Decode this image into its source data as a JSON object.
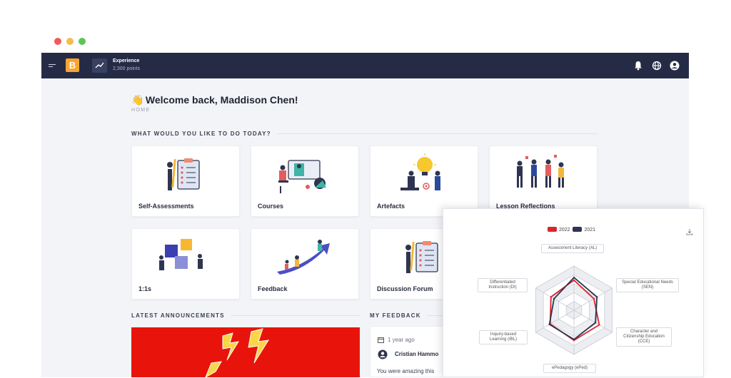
{
  "app": {
    "experience_title": "Experience",
    "experience_points": "2,300 points",
    "logo_letter": "B"
  },
  "page": {
    "welcome": "Welcome back, Maddison Chen!",
    "breadcrumb": "HOME",
    "todo_title": "WHAT WOULD YOU LIKE TO DO TODAY?",
    "announcements_title": "LATEST ANNOUNCEMENTS",
    "feedback_title": "MY FEEDBACK"
  },
  "cards": [
    {
      "label": "Self-Assessments",
      "icon": "clipboard-illustration"
    },
    {
      "label": "Courses",
      "icon": "online-course-illustration"
    },
    {
      "label": "Artefacts",
      "icon": "idea-illustration"
    },
    {
      "label": "Lesson Reflections",
      "icon": "team-illustration"
    },
    {
      "label": "1:1s",
      "icon": "puzzle-illustration"
    },
    {
      "label": "Feedback",
      "icon": "growth-arrow-illustration"
    },
    {
      "label": "Discussion Forum",
      "icon": "clipboard-illustration"
    }
  ],
  "feedback": {
    "time": "1 year ago",
    "name": "Cristian Hammo",
    "message": "You were amazing this"
  },
  "colors": {
    "topbar": "#262b45",
    "accent": "#f7a531",
    "series_2022": "#d8262d",
    "series_2021": "#2c3554"
  },
  "chart_data": {
    "type": "radar",
    "categories": [
      "Assessment Literacy (AL)",
      "Special Educational Needs (SEN)",
      "Character and Citizenship Education (CCE)",
      "ePedagogy (ePed)",
      "Inquiry-based Learning (IBL)",
      "Differentiated Instruction (DI)"
    ],
    "series": [
      {
        "name": "2022",
        "values": [
          3.4,
          2.6,
          3.3,
          3.4,
          3.1,
          3.0
        ]
      },
      {
        "name": "2021",
        "values": [
          3.7,
          3.0,
          2.8,
          3.3,
          3.2,
          2.6
        ]
      }
    ],
    "ylim": [
      0,
      5
    ],
    "legend": "top"
  }
}
